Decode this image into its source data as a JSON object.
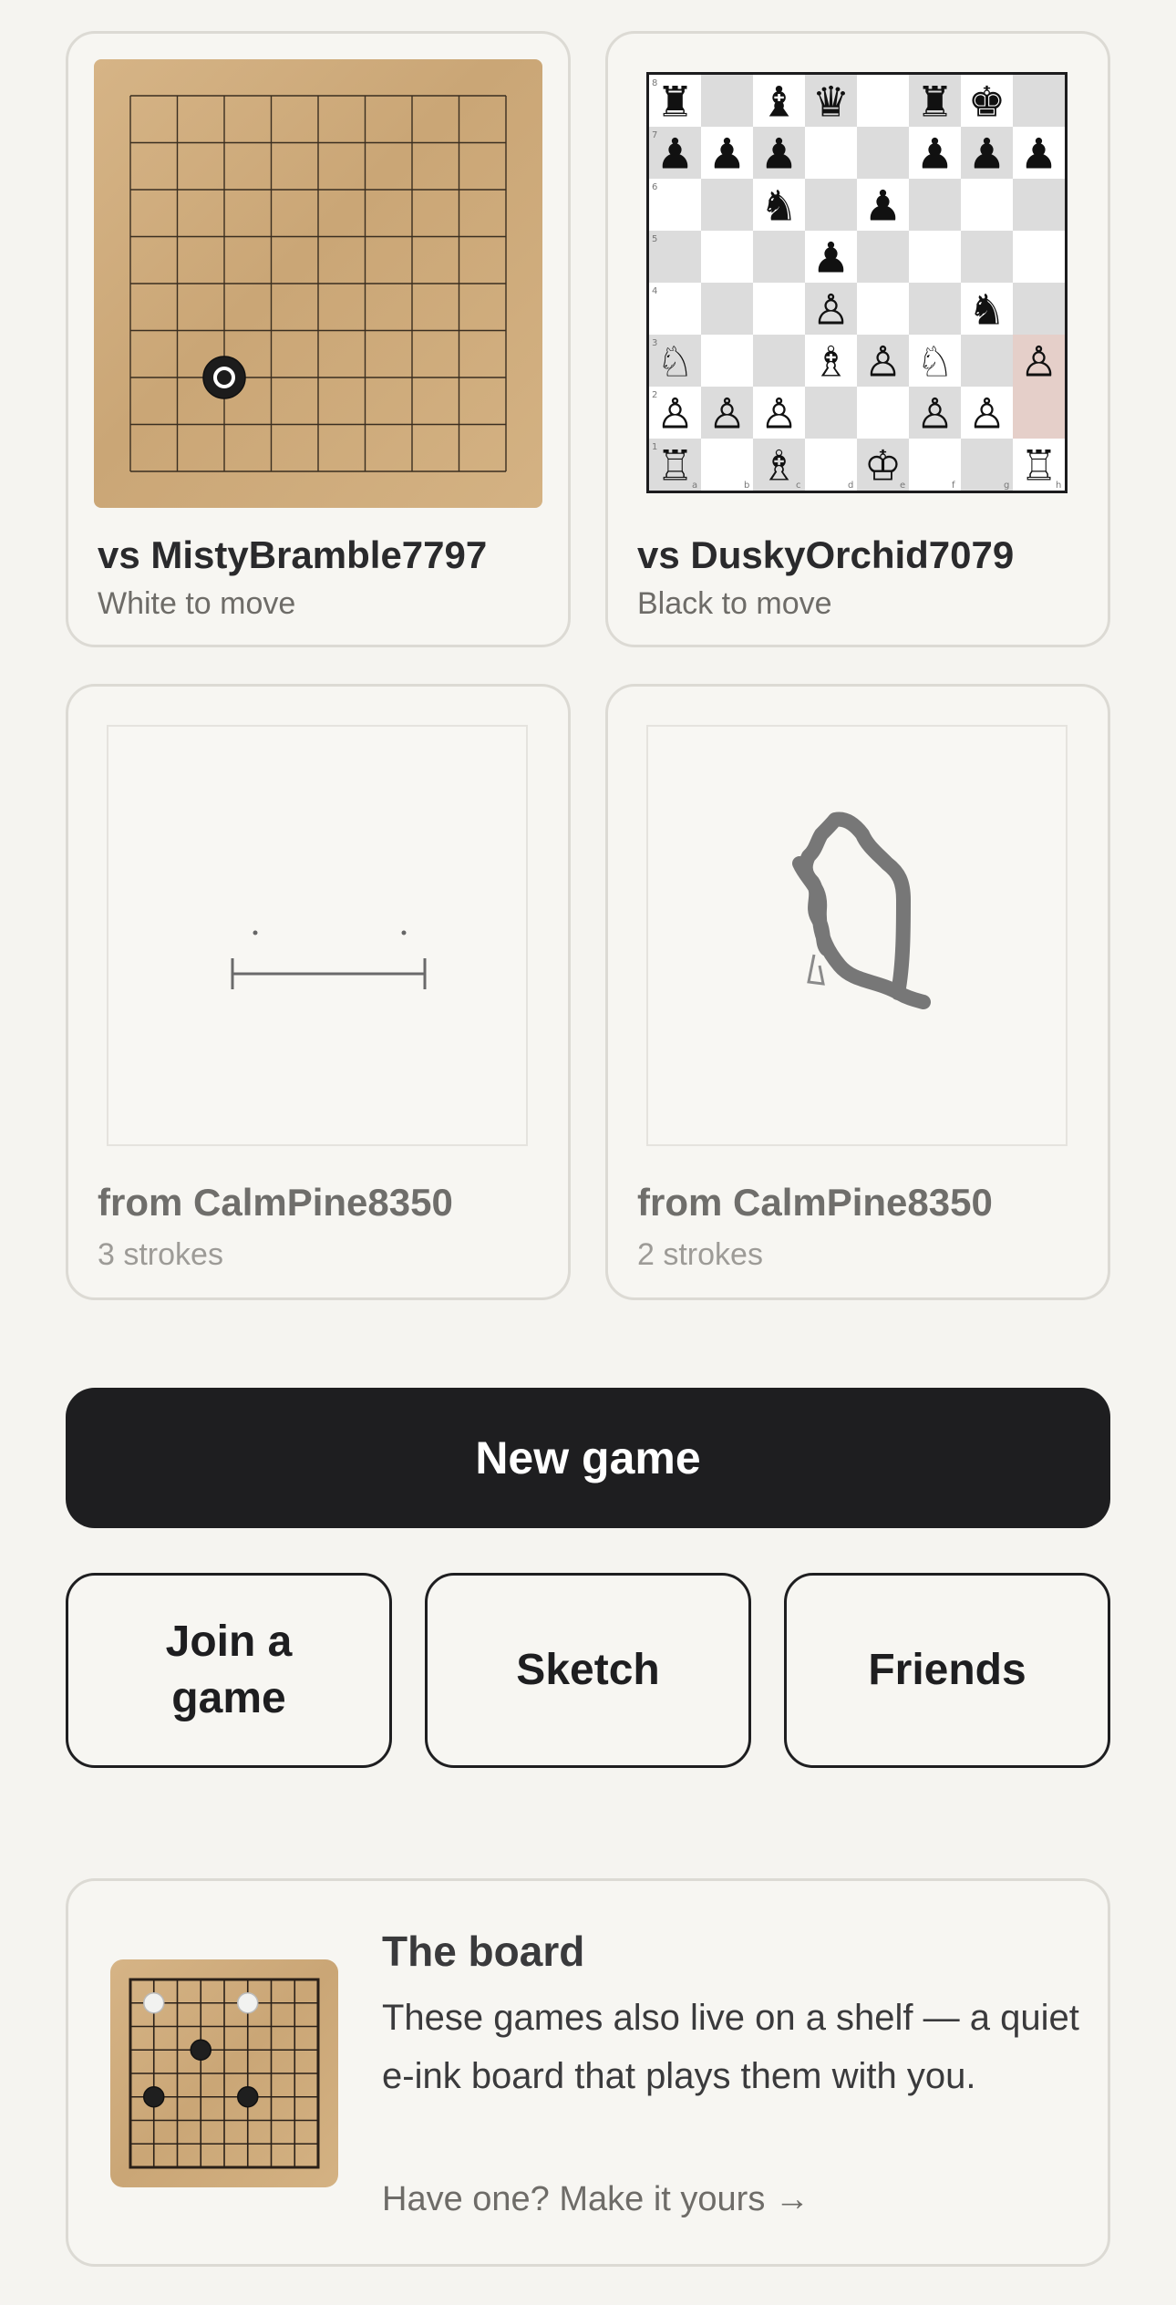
{
  "games": [
    {
      "title": "vs MistyBramble7797",
      "status": "White to move"
    },
    {
      "title": "vs DuskyOrchid7079",
      "status": "Black to move"
    }
  ],
  "sketches": [
    {
      "title": "from CalmPine8350",
      "status": "3 strokes"
    },
    {
      "title": "from CalmPine8350",
      "status": "2 strokes"
    }
  ],
  "actions": {
    "new_game": "New game",
    "join": "Join a game",
    "sketch": "Sketch",
    "friends": "Friends"
  },
  "promo": {
    "title": "The board",
    "text": "These games also live on a shelf — a quiet e-ink board that plays them with you.",
    "link": "Have one? Make it yours →"
  },
  "go_game": {
    "board_size": 9,
    "stones": [
      {
        "col": 2,
        "row": 6,
        "color": "black",
        "last_move": true
      }
    ]
  },
  "chess_game": {
    "ranks": [
      [
        "r",
        "",
        "b",
        "q",
        "",
        "r",
        "k",
        ""
      ],
      [
        "p",
        "p",
        "p",
        "",
        "",
        "p",
        "p",
        "p"
      ],
      [
        "",
        "",
        "n",
        "",
        "p",
        "",
        "",
        ""
      ],
      [
        "",
        "",
        "",
        "p",
        "",
        "",
        "",
        ""
      ],
      [
        "",
        "",
        "",
        "P",
        "",
        "",
        "n",
        ""
      ],
      [
        "N",
        "",
        "",
        "B",
        "P",
        "N",
        "",
        "P"
      ],
      [
        "P",
        "P",
        "P",
        "",
        "",
        "P",
        "P",
        ""
      ],
      [
        "R",
        "",
        "B",
        "",
        "K",
        "",
        "",
        "R"
      ]
    ],
    "rank_labels": [
      "8",
      "7",
      "6",
      "5",
      "4",
      "3",
      "2",
      "1"
    ],
    "file_labels": [
      "a",
      "b",
      "c",
      "d",
      "e",
      "f",
      "g",
      "h"
    ],
    "highlight_squares": [
      "h3",
      "h2"
    ],
    "highlight_color": "#e5cfc9"
  },
  "promo_board": {
    "board_size": 9,
    "stones": [
      {
        "col": 1,
        "row": 1,
        "color": "white"
      },
      {
        "col": 5,
        "row": 1,
        "color": "white"
      },
      {
        "col": 3,
        "row": 3,
        "color": "black"
      },
      {
        "col": 1,
        "row": 5,
        "color": "black"
      },
      {
        "col": 5,
        "row": 5,
        "color": "black"
      }
    ]
  },
  "colors": {
    "background": "#f5f4f0",
    "primary_button": "#1e1e20",
    "board_wood": "#cfae7f",
    "chess_dark_square": "#dcdcdc"
  }
}
